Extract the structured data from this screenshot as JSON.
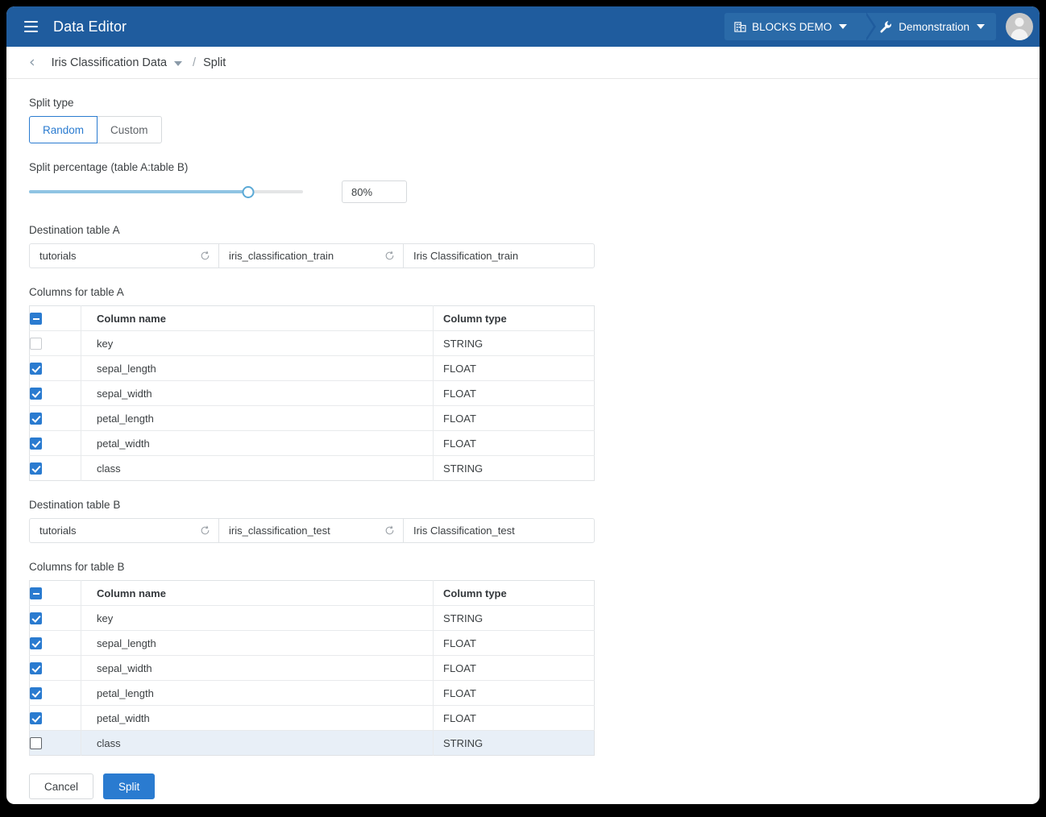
{
  "appbar": {
    "menu_icon": "hamburger-icon",
    "title": "Data Editor",
    "project_chip": {
      "icon": "building-icon",
      "label": "BLOCKS DEMO",
      "caret": "chevron-down-icon"
    },
    "env_chip": {
      "icon": "wrench-icon",
      "label": "Demonstration",
      "caret": "chevron-down-icon"
    },
    "avatar": "user-avatar",
    "bar_color": "#1f5c9e",
    "chip_color": "#2a6aa8"
  },
  "breadcrumb": {
    "back_icon": "chevron-left-icon",
    "parent": "Iris Classification Data",
    "parent_caret": "chevron-down-icon",
    "separator": "/",
    "current": "Split"
  },
  "split_type": {
    "label": "Split type",
    "options": [
      {
        "label": "Random",
        "selected": true
      },
      {
        "label": "Custom",
        "selected": false
      }
    ]
  },
  "split_percentage": {
    "label": "Split percentage (table A:table B)",
    "value": 80,
    "value_text": "80%",
    "min": 0,
    "max": 100,
    "fill_color": "#8fc4e3",
    "track_color": "#e4e5e6"
  },
  "destination_a": {
    "label": "Destination table A",
    "database": "tutorials",
    "table_name": "iris_classification_train",
    "display_name": "Iris Classification_train",
    "refresh_icon": "refresh-icon"
  },
  "columns_a": {
    "label": "Columns for table A",
    "header_checkbox_state": "indeterminate",
    "headers": {
      "name": "Column name",
      "type": "Column type"
    },
    "rows": [
      {
        "checked": false,
        "name": "key",
        "type": "STRING"
      },
      {
        "checked": true,
        "name": "sepal_length",
        "type": "FLOAT"
      },
      {
        "checked": true,
        "name": "sepal_width",
        "type": "FLOAT"
      },
      {
        "checked": true,
        "name": "petal_length",
        "type": "FLOAT"
      },
      {
        "checked": true,
        "name": "petal_width",
        "type": "FLOAT"
      },
      {
        "checked": true,
        "name": "class",
        "type": "STRING"
      }
    ]
  },
  "destination_b": {
    "label": "Destination table B",
    "database": "tutorials",
    "table_name": "iris_classification_test",
    "display_name": "Iris Classification_test",
    "refresh_icon": "refresh-icon"
  },
  "columns_b": {
    "label": "Columns for table B",
    "header_checkbox_state": "indeterminate",
    "headers": {
      "name": "Column name",
      "type": "Column type"
    },
    "rows": [
      {
        "checked": true,
        "name": "key",
        "type": "STRING"
      },
      {
        "checked": true,
        "name": "sepal_length",
        "type": "FLOAT"
      },
      {
        "checked": true,
        "name": "sepal_width",
        "type": "FLOAT"
      },
      {
        "checked": true,
        "name": "petal_length",
        "type": "FLOAT"
      },
      {
        "checked": true,
        "name": "petal_width",
        "type": "FLOAT"
      },
      {
        "checked": false,
        "name": "class",
        "type": "STRING",
        "highlighted": true
      }
    ]
  },
  "footer": {
    "cancel_label": "Cancel",
    "split_label": "Split",
    "primary_color": "#2a7bd0"
  }
}
